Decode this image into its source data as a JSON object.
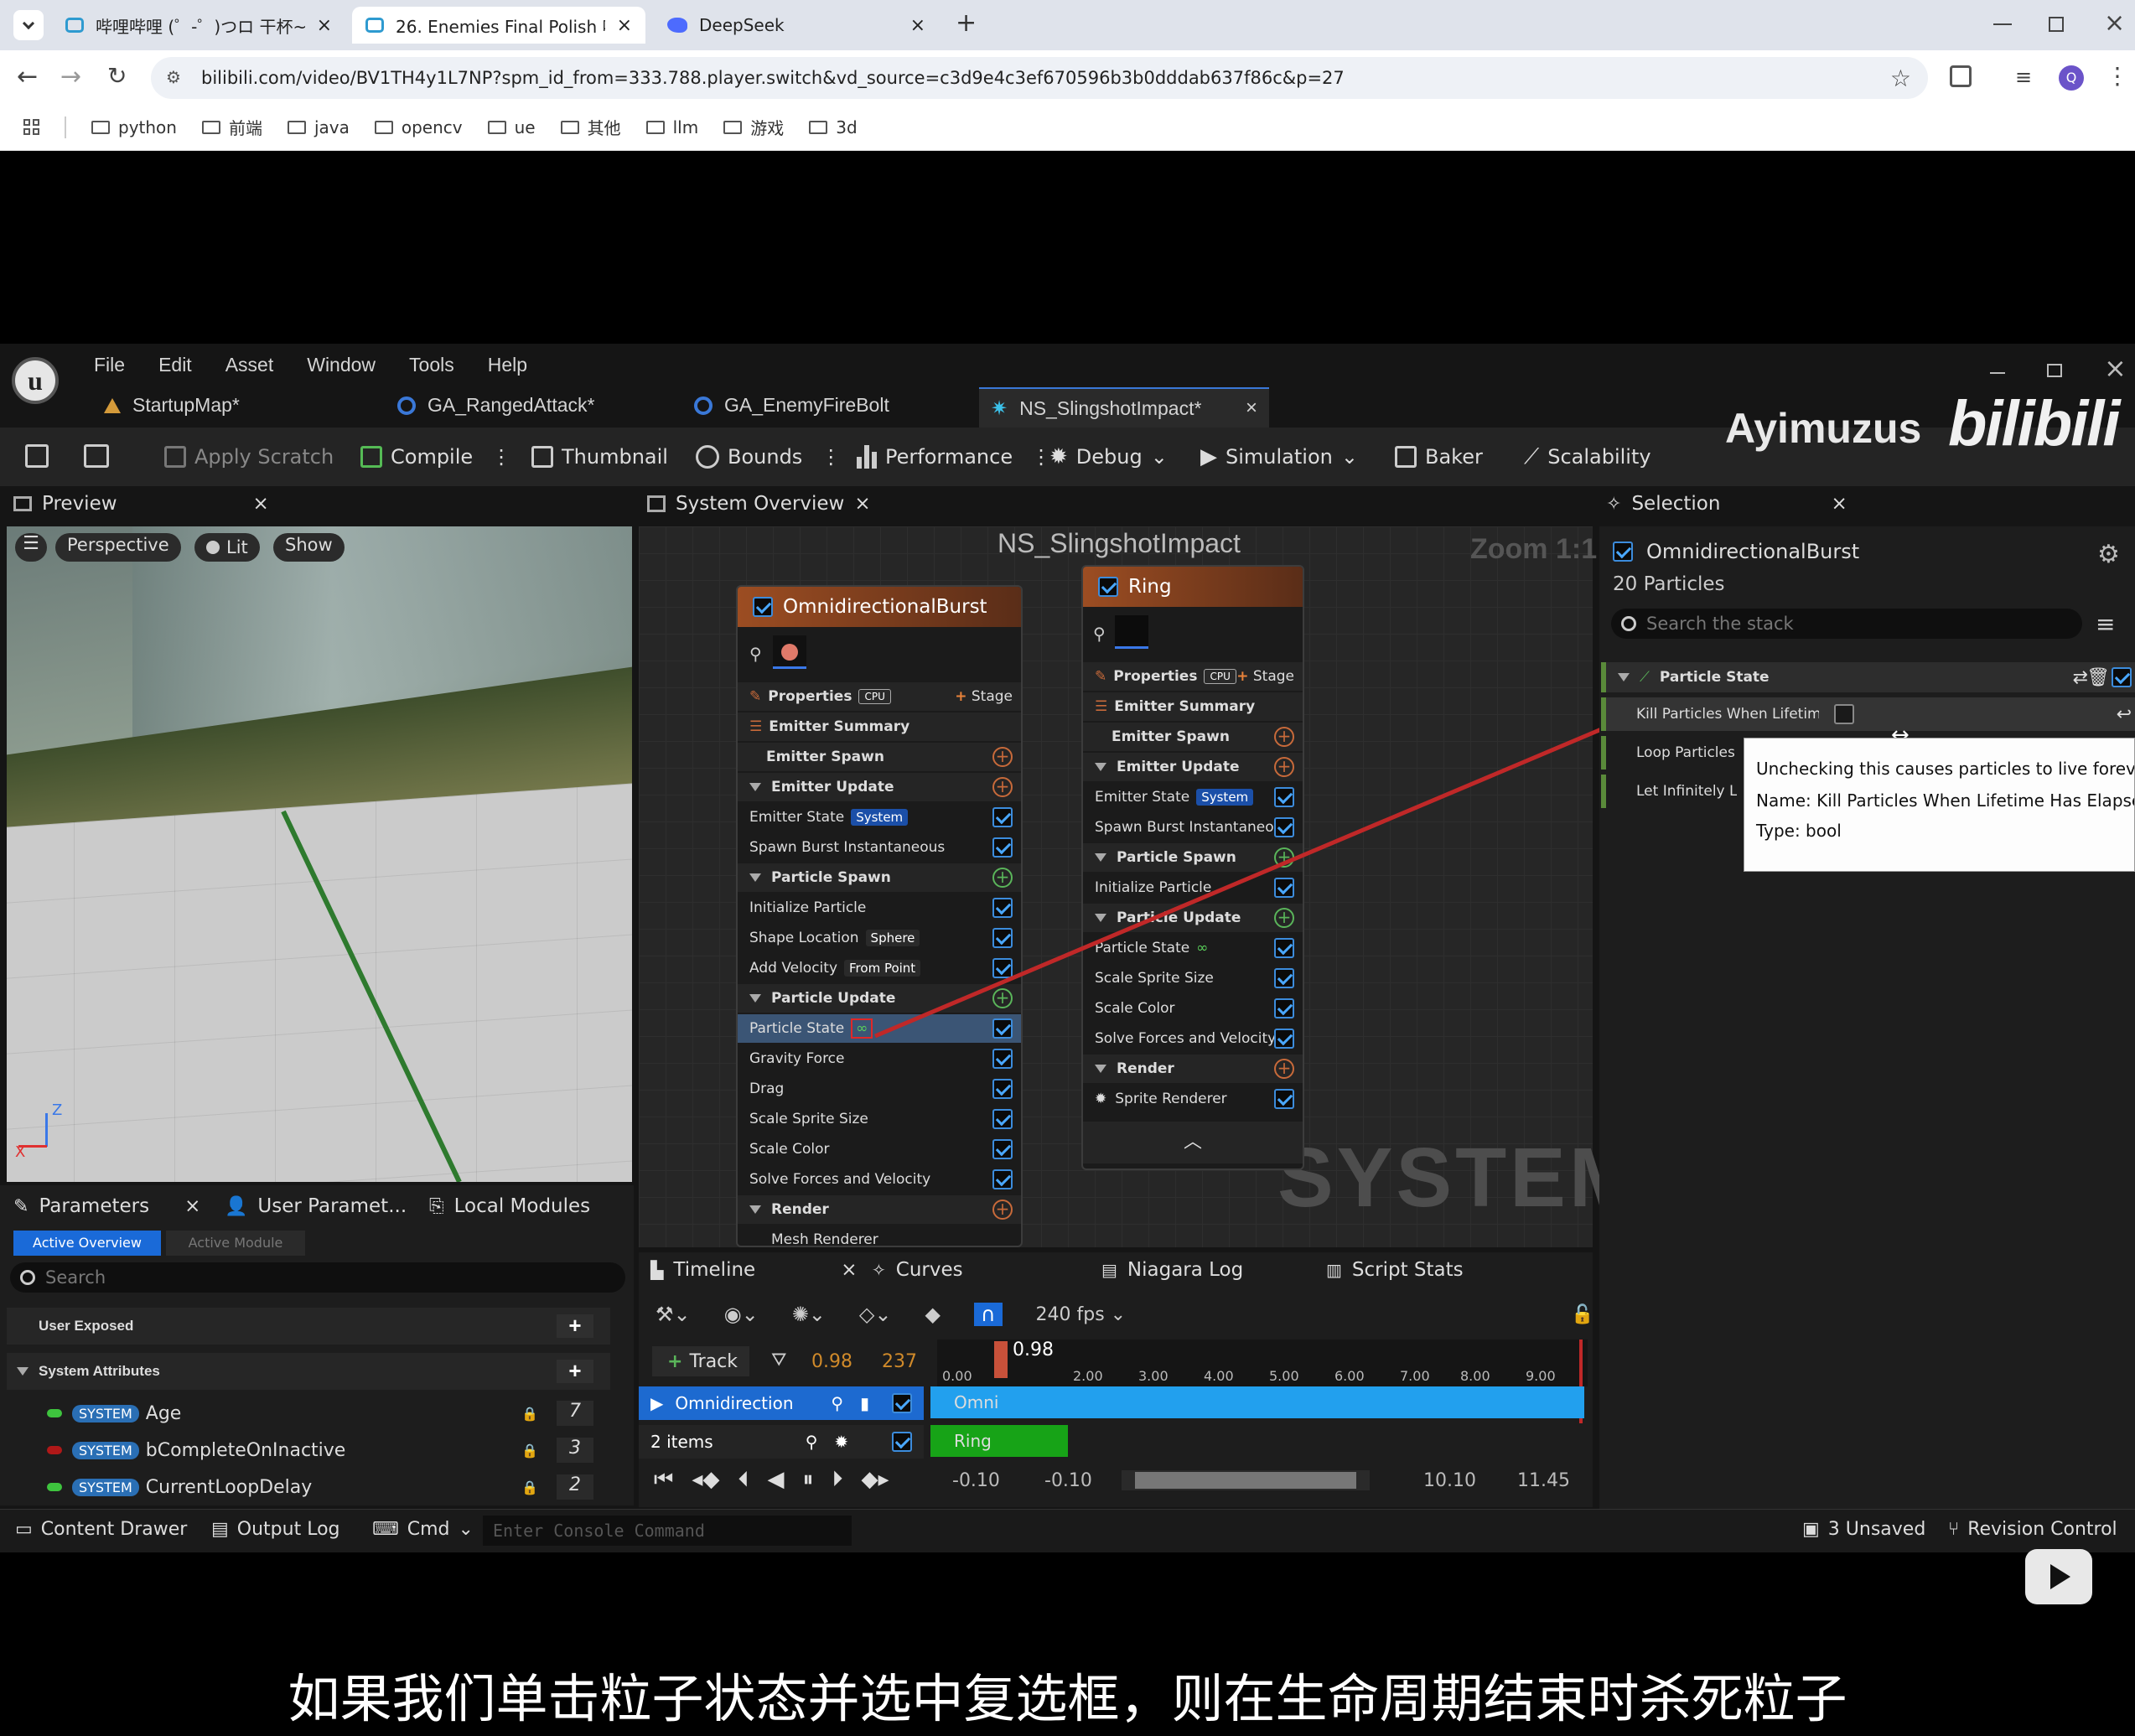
{
  "browser": {
    "tabs": [
      {
        "title": "哔哩哔哩 (゜-゜)つロ 干杯~-bi",
        "active": false
      },
      {
        "title": "26. Enemies Final Polish 哔哩",
        "active": true
      },
      {
        "title": "DeepSeek",
        "active": false
      }
    ],
    "url": "bilibili.com/video/BV1TH4y1L7NP?spm_id_from=333.788.player.switch&vd_source=c3d9e4c3ef670596b3b0dddab637f86c&p=27",
    "avatar_letter": "Q",
    "bookmarks": [
      "python",
      "前端",
      "java",
      "opencv",
      "ue",
      "其他",
      "llm",
      "游戏",
      "3d"
    ]
  },
  "ue": {
    "menu": [
      "File",
      "Edit",
      "Asset",
      "Window",
      "Tools",
      "Help"
    ],
    "doc_tabs": [
      "StartupMap*",
      "GA_RangedAttack*",
      "GA_EnemyFireBolt",
      "NS_SlingshotImpact*"
    ],
    "toolbar": {
      "apply_scratch": "Apply Scratch",
      "compile": "Compile",
      "thumbnail": "Thumbnail",
      "bounds": "Bounds",
      "performance": "Performance",
      "debug": "Debug",
      "simulation": "Simulation",
      "baker": "Baker",
      "scalability": "Scalability"
    },
    "watermark": "Ayimuzus",
    "watermark_logo": "bilibili",
    "preview": {
      "tab": "Preview",
      "perspective": "Perspective",
      "lit": "Lit",
      "show": "Show",
      "axis_z": "Z",
      "axis_x": "X"
    },
    "system_overview": {
      "tab": "System Overview",
      "title": "NS_SlingshotImpact",
      "zoom": "Zoom 1:1",
      "system_label": "SYSTEM"
    },
    "node1": {
      "title": "OmnidirectionalBurst",
      "properties": "Properties",
      "cpu": "CPU",
      "stage": "Stage",
      "emitter_summary": "Emitter Summary",
      "emitter_spawn": "Emitter Spawn",
      "emitter_update": "Emitter Update",
      "emitter_state": "Emitter State",
      "system_pill": "System",
      "spawn_burst": "Spawn Burst Instantaneous",
      "particle_spawn": "Particle Spawn",
      "initialize_particle": "Initialize Particle",
      "shape_location": "Shape Location",
      "sphere": "Sphere",
      "add_velocity": "Add Velocity",
      "from_point": "From Point",
      "particle_update": "Particle Update",
      "particle_state": "Particle State",
      "infinity": "∞",
      "gravity_force": "Gravity Force",
      "drag": "Drag",
      "scale_sprite_size": "Scale Sprite Size",
      "scale_color": "Scale Color",
      "solve_forces": "Solve Forces and Velocity",
      "render": "Render",
      "mesh_renderer": "Mesh Renderer"
    },
    "node2": {
      "title": "Ring",
      "properties": "Properties",
      "cpu": "CPU",
      "stage": "Stage",
      "emitter_summary": "Emitter Summary",
      "emitter_spawn": "Emitter Spawn",
      "emitter_update": "Emitter Update",
      "emitter_state": "Emitter State",
      "system_pill": "System",
      "spawn_burst": "Spawn Burst Instantaneous",
      "particle_spawn": "Particle Spawn",
      "initialize_particle": "Initialize Particle",
      "particle_update": "Particle Update",
      "particle_state": "Particle State",
      "infinity": "∞",
      "scale_sprite_size": "Scale Sprite Size",
      "scale_color": "Scale Color",
      "solve_forces": "Solve Forces and Velocity",
      "render": "Render",
      "sprite_renderer": "Sprite Renderer"
    },
    "selection": {
      "tab": "Selection",
      "emitter_name": "OmnidirectionalBurst",
      "particles": "20 Particles",
      "search_placeholder": "Search the stack",
      "section": "Particle State",
      "rows": [
        "Kill Particles When Lifetime Has Elapsed",
        "Loop Particles Lifetime",
        "Let Infinitely Lived Particles"
      ],
      "tooltip": {
        "line1": "Unchecking this causes particles to live forever.",
        "line2": "Name: Kill Particles When Lifetime Has Elapsed",
        "line3": "Type: bool"
      }
    },
    "parameters": {
      "tabs": [
        "Parameters",
        "User Paramet...",
        "Local Modules"
      ],
      "active_overview": "Active Overview",
      "active_module": "Active Module",
      "search_placeholder": "Search",
      "user_exposed": "User Exposed",
      "system_attributes": "System Attributes",
      "system_tag": "SYSTEM",
      "rows": [
        {
          "name": "Age",
          "value": "7",
          "color": "#3ec43e"
        },
        {
          "name": "bCompleteOnInactive",
          "value": "3",
          "color": "#b01818"
        },
        {
          "name": "CurrentLoopDelay",
          "value": "2",
          "color": "#3ec43e"
        }
      ]
    },
    "timeline": {
      "tabs": [
        "Timeline",
        "Curves",
        "Niagara Log",
        "Script Stats"
      ],
      "fps": "240 fps",
      "track": "Track",
      "time_a": "0.98",
      "time_b": "237",
      "playhead": "0.98",
      "ticks": [
        "0.00",
        "2.00",
        "3.00",
        "4.00",
        "5.00",
        "6.00",
        "7.00",
        "8.00",
        "9.00"
      ],
      "track_rows": [
        {
          "name": "Omnidirection",
          "bar_label": "Omni",
          "color": "#22a0ee"
        },
        {
          "name": "2 items",
          "bar_label": "Ring",
          "color": "#17a317"
        }
      ],
      "range": [
        "-0.10",
        "-0.10",
        "10.10",
        "11.45"
      ]
    },
    "statusbar": {
      "content_drawer": "Content Drawer",
      "output_log": "Output Log",
      "cmd": "Cmd",
      "console_placeholder": "Enter Console Command",
      "unsaved": "3 Unsaved",
      "revision": "Revision Control"
    }
  },
  "subtitle": "如果我们单击粒子状态并选中复选框，则在生命周期结束时杀死粒子"
}
